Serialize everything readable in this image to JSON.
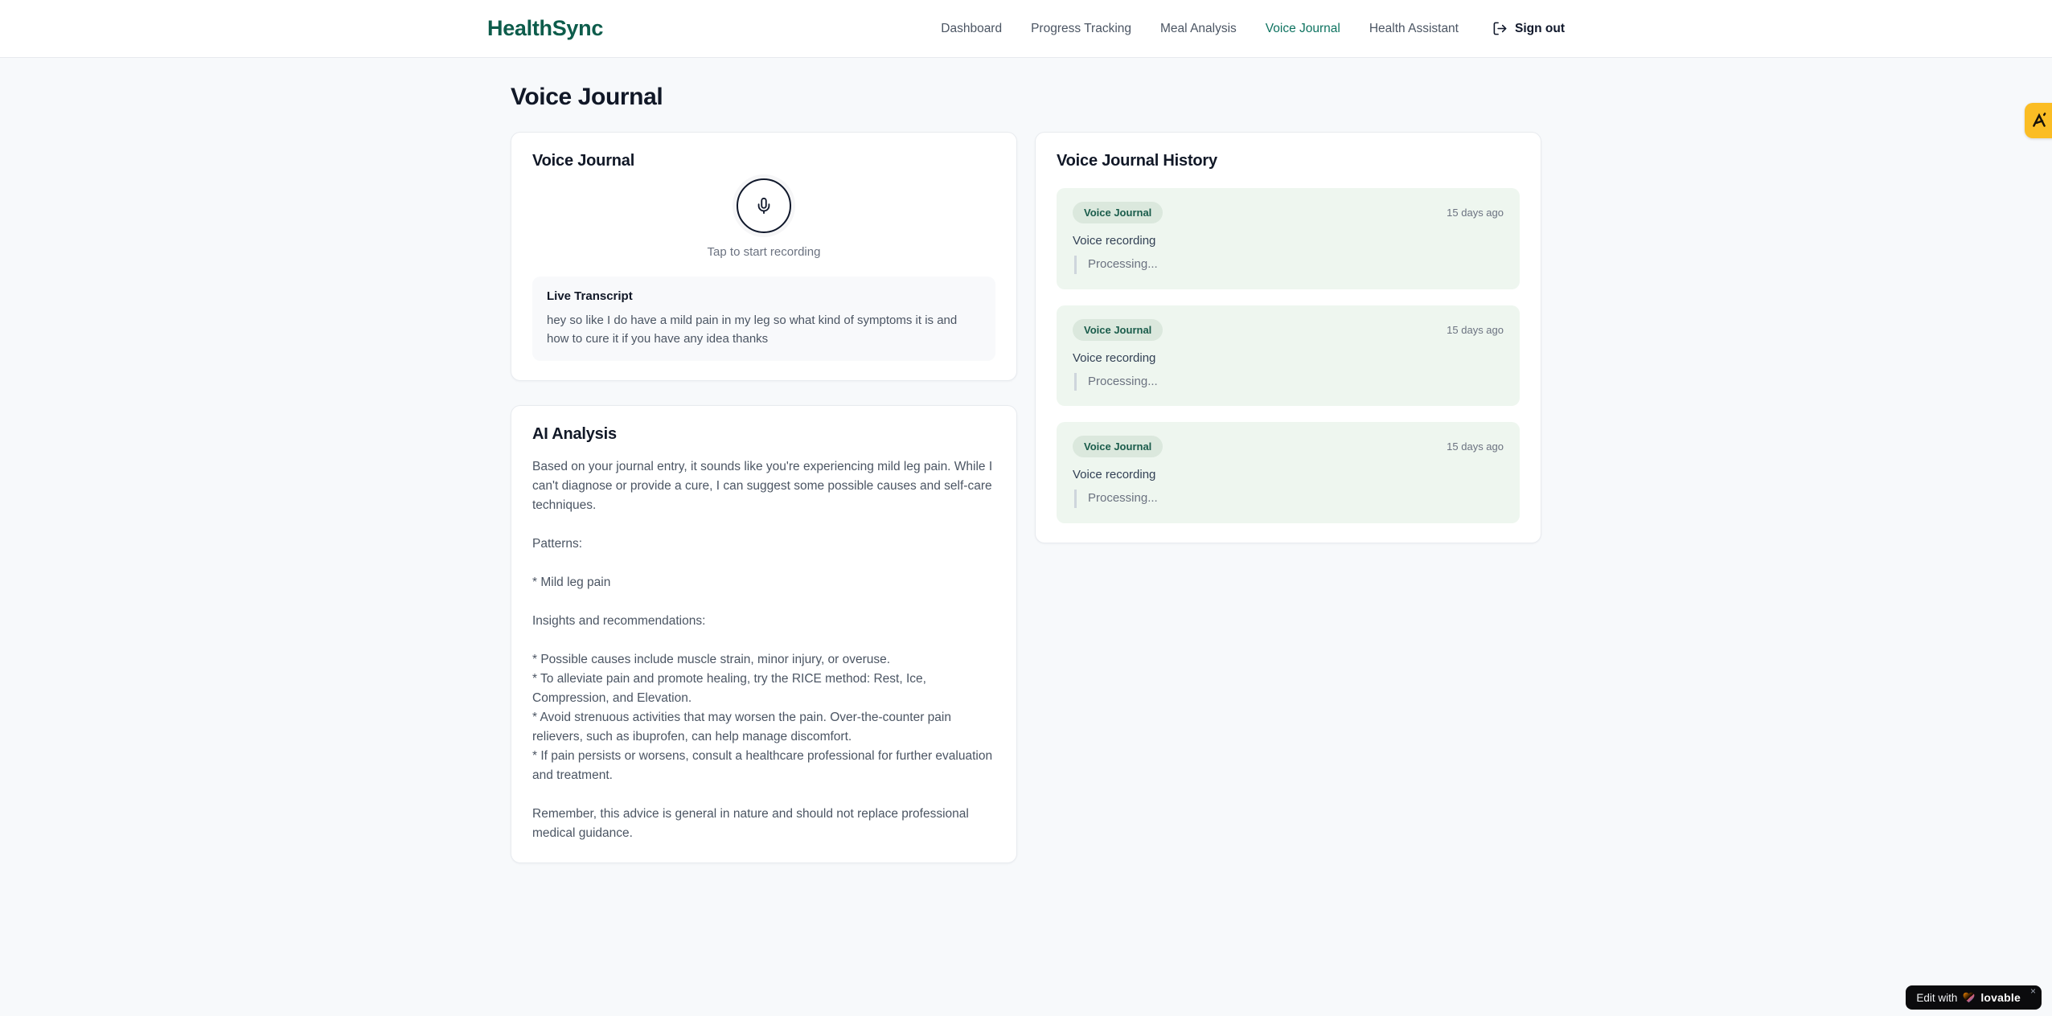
{
  "brand": {
    "name": "HealthSync"
  },
  "nav": {
    "items": [
      "Dashboard",
      "Progress Tracking",
      "Meal Analysis",
      "Voice Journal",
      "Health Assistant"
    ],
    "active_item": "Voice Journal",
    "sign_out_label": "Sign out"
  },
  "page": {
    "title": "Voice Journal"
  },
  "recorder_card": {
    "title": "Voice Journal",
    "mic_icon": "microphone-icon",
    "mic_hint": "Tap to start recording",
    "transcript_title": "Live Transcript",
    "transcript_text": "hey so like I do have a mild pain in my leg so what kind of symptoms it is and how to cure it if you have any idea thanks"
  },
  "analysis_card": {
    "title": "AI Analysis",
    "body": "Based on your journal entry, it sounds like you're experiencing mild leg pain. While I can't diagnose or provide a cure, I can suggest some possible causes and self-care techniques.\n\nPatterns:\n\n* Mild leg pain\n\nInsights and recommendations:\n\n* Possible causes include muscle strain, minor injury, or overuse.\n* To alleviate pain and promote healing, try the RICE method: Rest, Ice, Compression, and Elevation.\n* Avoid strenuous activities that may worsen the pain. Over-the-counter pain relievers, such as ibuprofen, can help manage discomfort.\n* If pain persists or worsens, consult a healthcare professional for further evaluation and treatment.\n\nRemember, this advice is general in nature and should not replace professional medical guidance."
  },
  "history_card": {
    "title": "Voice Journal History",
    "entries": [
      {
        "badge": "Voice Journal",
        "time_ago": "15 days ago",
        "label": "Voice recording",
        "status": "Processing..."
      },
      {
        "badge": "Voice Journal",
        "time_ago": "15 days ago",
        "label": "Voice recording",
        "status": "Processing..."
      },
      {
        "badge": "Voice Journal",
        "time_ago": "15 days ago",
        "label": "Voice recording",
        "status": "Processing..."
      }
    ]
  },
  "floating": {
    "edit_badge_prefix": "Edit with",
    "edit_badge_brand": "lovable",
    "edit_badge_close": "×"
  },
  "colors": {
    "brand_green": "#0d5c4b",
    "active_nav_green": "#0e7360",
    "entry_bg_green": "#eef6ef",
    "badge_bg_green": "#dbe8dd",
    "badge_text_green": "#1a5c4b",
    "side_badge_amber": "#fbbd24",
    "page_bg": "#f7f9fb"
  }
}
